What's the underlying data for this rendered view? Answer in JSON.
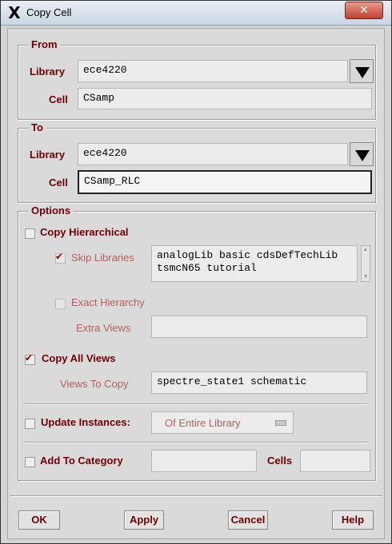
{
  "window": {
    "title": "Copy Cell",
    "close_glyph": "✕",
    "icon": "x-window-icon"
  },
  "from": {
    "title": "From",
    "library_label": "Library",
    "library_value": "ece4220",
    "cell_label": "Cell",
    "cell_value": "CSamp"
  },
  "to": {
    "title": "To",
    "library_label": "Library",
    "library_value": "ece4220",
    "cell_label": "Cell",
    "cell_value": "CSamp_RLC"
  },
  "options": {
    "title": "Options",
    "copy_hierarchical": "Copy Hierarchical",
    "skip_libraries_label": "Skip Libraries",
    "skip_libraries_value": "analogLib basic cdsDefTechLib\ntsmcN65 tutorial",
    "exact_hierarchy": "Exact Hierarchy",
    "extra_views_label": "Extra Views",
    "extra_views_value": "",
    "copy_all_views": "Copy All Views",
    "views_to_copy_label": "Views To Copy",
    "views_to_copy_value": "spectre_state1 schematic",
    "update_instances": "Update Instances:",
    "update_instances_value": "Of Entire Library",
    "add_to_category": "Add To Category",
    "category_value": "",
    "cells_label": "Cells",
    "cells_value": ""
  },
  "buttons": {
    "ok": "OK",
    "apply": "Apply",
    "cancel": "Cancel",
    "help": "Help"
  },
  "colors": {
    "label": "#6e0000",
    "disabled_label": "#b06060"
  }
}
